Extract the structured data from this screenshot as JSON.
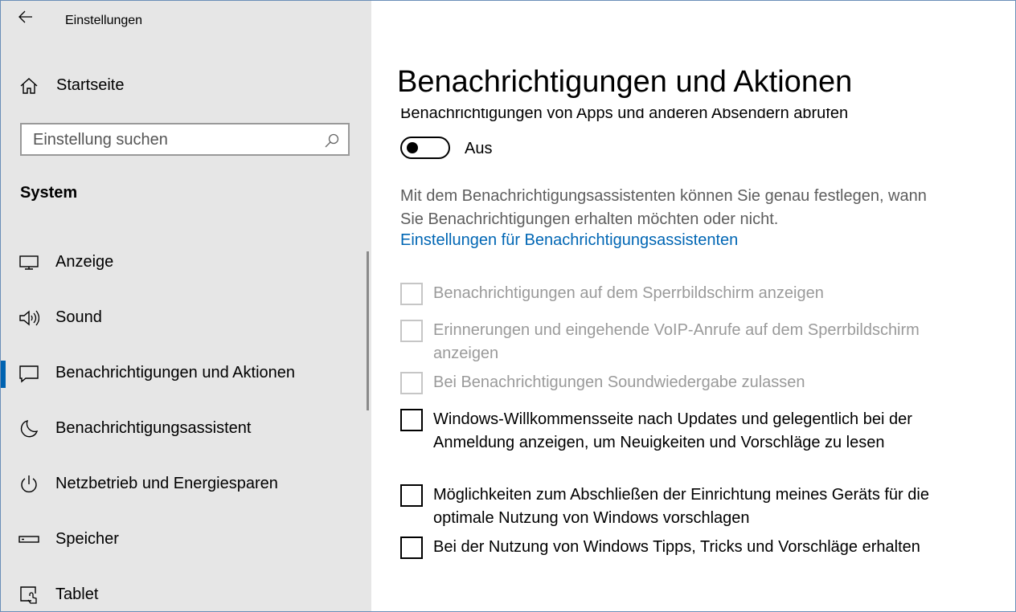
{
  "window": {
    "app_title": "Einstellungen",
    "controls": [
      "minimize",
      "maximize",
      "close"
    ]
  },
  "sidebar": {
    "home_label": "Startseite",
    "search": {
      "placeholder": "Einstellung suchen"
    },
    "section_title": "System",
    "items": [
      {
        "label": "Anzeige",
        "icon": "monitor-icon",
        "selected": false
      },
      {
        "label": "Sound",
        "icon": "speaker-icon",
        "selected": false
      },
      {
        "label": "Benachrichtigungen und Aktionen",
        "icon": "notification-icon",
        "selected": true
      },
      {
        "label": "Benachrichtigungsassistent",
        "icon": "moon-icon",
        "selected": false
      },
      {
        "label": "Netzbetrieb und Energiesparen",
        "icon": "power-icon",
        "selected": false
      },
      {
        "label": "Speicher",
        "icon": "storage-icon",
        "selected": false
      },
      {
        "label": "Tablet",
        "icon": "tablet-icon",
        "selected": false
      }
    ]
  },
  "main": {
    "title": "Benachrichtigungen und Aktionen",
    "toggle": {
      "label": "Benachrichtigungen von Apps und anderen Absendern abrufen",
      "state_text": "Aus",
      "on": false
    },
    "description": "Mit dem Benachrichtigungsassistenten können Sie genau festlegen, wann Sie Benachrichtigungen erhalten möchten oder nicht.",
    "link": "Einstellungen für Benachrichtigungsassistenten",
    "checkboxes": [
      {
        "label": "Benachrichtigungen auf dem Sperrbildschirm anzeigen",
        "checked": false,
        "disabled": true
      },
      {
        "label": "Erinnerungen und eingehende VoIP-Anrufe auf dem Sperrbildschirm anzeigen",
        "checked": false,
        "disabled": true
      },
      {
        "label": "Bei Benachrichtigungen Soundwiedergabe zulassen",
        "checked": false,
        "disabled": true
      },
      {
        "label": "Windows-Willkommensseite nach Updates und gelegentlich bei der Anmeldung anzeigen, um Neuigkeiten und Vorschläge zu lesen",
        "checked": false,
        "disabled": false
      },
      {
        "label": "Möglichkeiten zum Abschließen der Einrichtung meines Geräts für die optimale Nutzung von Windows vorschlagen",
        "checked": false,
        "disabled": false
      },
      {
        "label": "Bei der Nutzung von Windows Tipps, Tricks und Vorschläge erhalten",
        "checked": false,
        "disabled": false
      }
    ]
  },
  "colors": {
    "sidebar_bg": "#e6e6e6",
    "accent": "#0063b1",
    "link": "#0066b4",
    "disabled_text": "#9a9a9a"
  }
}
